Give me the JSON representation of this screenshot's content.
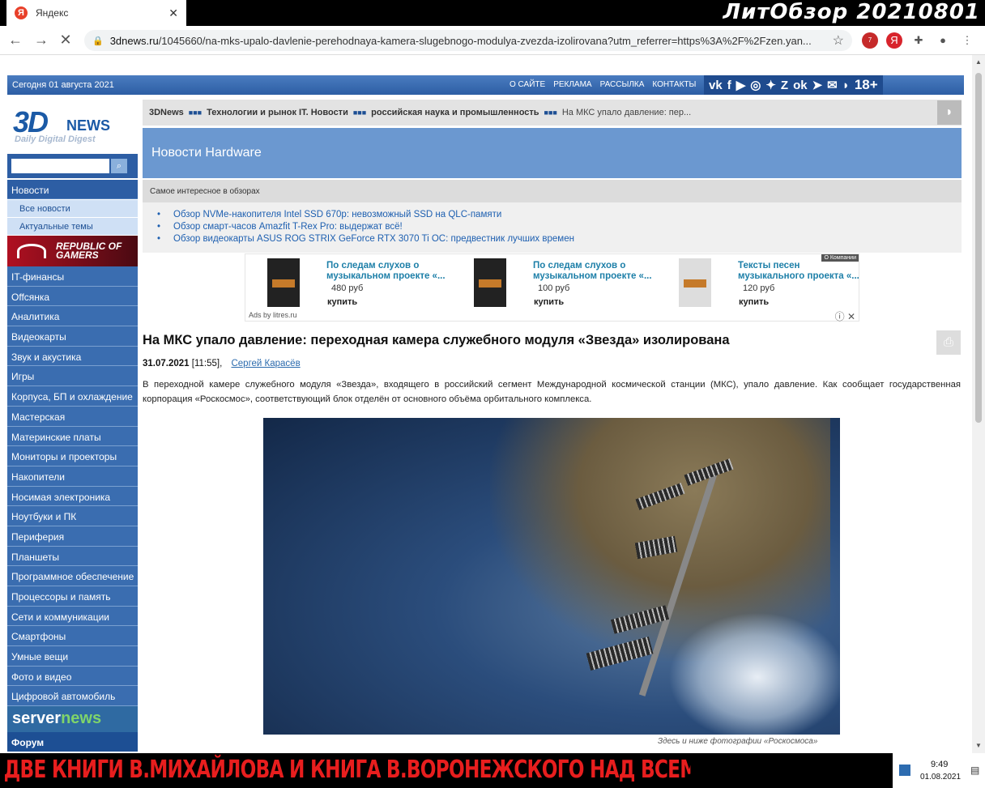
{
  "browser": {
    "tab_title": "Яндекс",
    "tab_favicon": "Я",
    "url_domain": "3dnews.ru",
    "url_path": "/1045660/na-mks-upalo-davlenie-perehodnaya-kamera-slugebnogo-modulya-zvezda-izolirovana?utm_referrer=https%3A%2F%2Fzen.yan...",
    "extension_badge": "7"
  },
  "overlay": {
    "watermark": "ЛитОбзор 20210801",
    "bottom_banner": "ДВЕ КНИГИ В.МИХАЙЛОВА И КНИГА В.ВОРОНЕЖСКОГО НАД ВСЕМ ЗЕМНЫМ ШАРОМ"
  },
  "site": {
    "date": "Сегодня 01 августа 2021",
    "top_menu": [
      "О САЙТЕ",
      "РЕКЛАМА",
      "РАССЫЛКА",
      "КОНТАКТЫ"
    ],
    "age": "18+",
    "logo_main": "3D",
    "logo_news": "NEWS",
    "logo_tagline": "Daily Digital Digest"
  },
  "sidebar": {
    "news": "Новости",
    "sub": [
      "Все новости",
      "Актуальные темы"
    ],
    "rog": "REPUBLIC OF GAMERS",
    "items": [
      "IT-финансы",
      "Offсянка",
      "Аналитика",
      "Видеокарты",
      "Звук и акустика",
      "Игры",
      "Корпуса, БП и охлаждение",
      "Мастерская",
      "Материнские платы",
      "Мониторы и проекторы",
      "Накопители",
      "Носимая электроника",
      "Ноутбуки и ПК",
      "Периферия",
      "Планшеты",
      "Программное обеспечение",
      "Процессоры и память",
      "Сети и коммуникации",
      "Смартфоны",
      "Умные вещи",
      "Фото и видео",
      "Цифровой автомобиль"
    ],
    "servernews_a": "server",
    "servernews_b": "news",
    "forum": "Форум"
  },
  "breadcrumb": {
    "items": [
      "3DNews",
      "Технологии и рынок IT. Новости",
      "российская наука и промышленность"
    ],
    "current": "На МКС упало давление: пер..."
  },
  "section_title": "Новости Hardware",
  "interesting_title": "Самое интересное в обзорах",
  "reviews": [
    "Обзор NVMe-накопителя Intel SSD 670p: невозможный SSD на QLC-памяти",
    "Обзор смарт-часов Amazfit T-Rex Pro: выдержат всё!",
    "Обзор видеокарты ASUS ROG STRIX GeForce RTX 3070 Ti OC: предвестник лучших времен"
  ],
  "ad": {
    "books": [
      {
        "title": "По следам слухов о музыкальном проекте «...",
        "price": "480 руб",
        "buy": "купить"
      },
      {
        "title": "По следам слухов о музыкальном проекте «...",
        "price": "100 руб",
        "buy": "купить"
      },
      {
        "title": "Тексты песен музыкального проекта «...",
        "price": "120 руб",
        "buy": "купить"
      }
    ],
    "source": "Ads by litres.ru",
    "company": "О Компании"
  },
  "article": {
    "title": "На МКС упало давление: переходная камера служебного модуля «Звезда» изолирована",
    "date": "31.07.2021",
    "time": "[11:55],",
    "author": "Сергей Карасёв",
    "lead": "В переходной камере служебного модуля «Звезда», входящего в российский сегмент Международной космической станции (МКС), упало давление. Как сообщает государственная корпорация «Роскосмос», соответствующий блок отделён от основного объёма орбитального комплекса.",
    "caption": "Здесь и ниже фотографии «Роскосмоса»"
  },
  "taskbar": {
    "time": "9:49",
    "date": "01.08.2021"
  }
}
